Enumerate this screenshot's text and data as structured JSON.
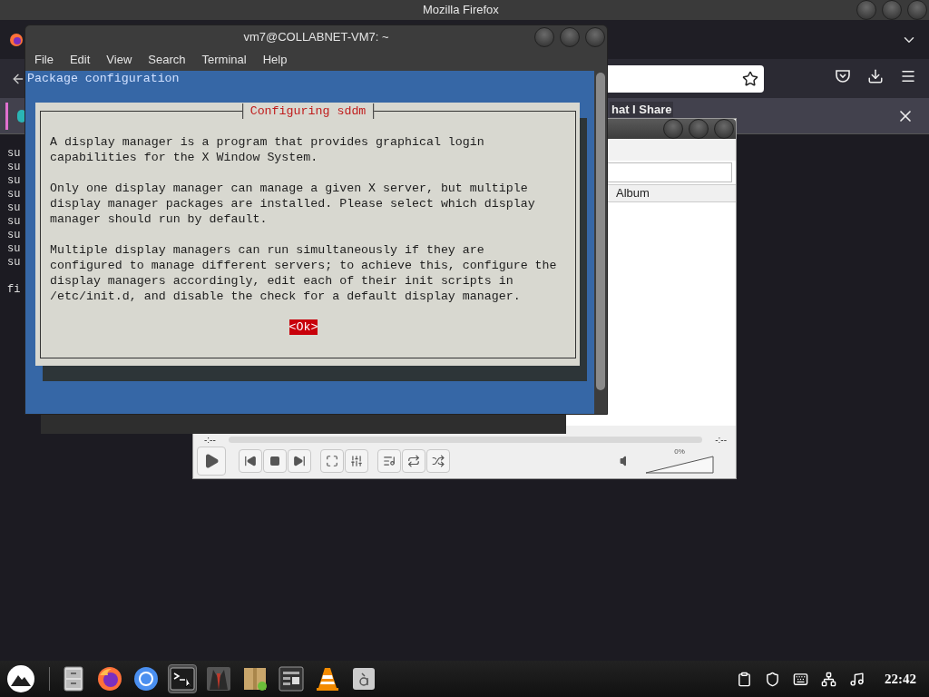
{
  "firefox": {
    "title": "Mozilla Firefox",
    "notification_tab": "hat I Share"
  },
  "background_terminal": {
    "blocks": [
      [
        "su",
        "su",
        "su",
        "su",
        "su",
        "su",
        "su",
        "su",
        "su"
      ],
      [
        "fi"
      ]
    ]
  },
  "terminal": {
    "title": "vm7@COLLABNET-VM7: ~",
    "menu": [
      "File",
      "Edit",
      "View",
      "Search",
      "Terminal",
      "Help"
    ],
    "screen_title": "Package configuration",
    "dialog": {
      "title": "Configuring sddm",
      "paragraphs": [
        [
          "A display manager is a program that provides graphical login",
          "capabilities for the X Window System."
        ],
        [
          "Only one display manager can manage a given X server, but multiple",
          "display manager packages are installed. Please select which display",
          "manager should run by default."
        ],
        [
          "Multiple display managers can run simultaneously if they are",
          "configured to manage different servers; to achieve this, configure the",
          "display managers accordingly, edit each of their init scripts in",
          "/etc/init.d, and disable the check for a default display manager."
        ]
      ],
      "button": {
        "label": "<Ok>",
        "selected": true
      }
    }
  },
  "vlc": {
    "column": "Album",
    "time_elapsed": "-:--",
    "time_total": "-:--",
    "volume": {
      "reading": "0%"
    }
  },
  "taskbar": {
    "apps": [
      {
        "kind": "files",
        "selected": false
      },
      {
        "kind": "firefox",
        "selected": false
      },
      {
        "kind": "chromium",
        "selected": false
      },
      {
        "kind": "terminal",
        "selected": true
      },
      {
        "kind": "suit",
        "selected": false
      },
      {
        "kind": "package",
        "selected": false
      },
      {
        "kind": "calculator",
        "selected": false
      },
      {
        "kind": "vlc",
        "selected": false
      },
      {
        "kind": "font",
        "selected": false
      }
    ],
    "clock": "22:42"
  }
}
